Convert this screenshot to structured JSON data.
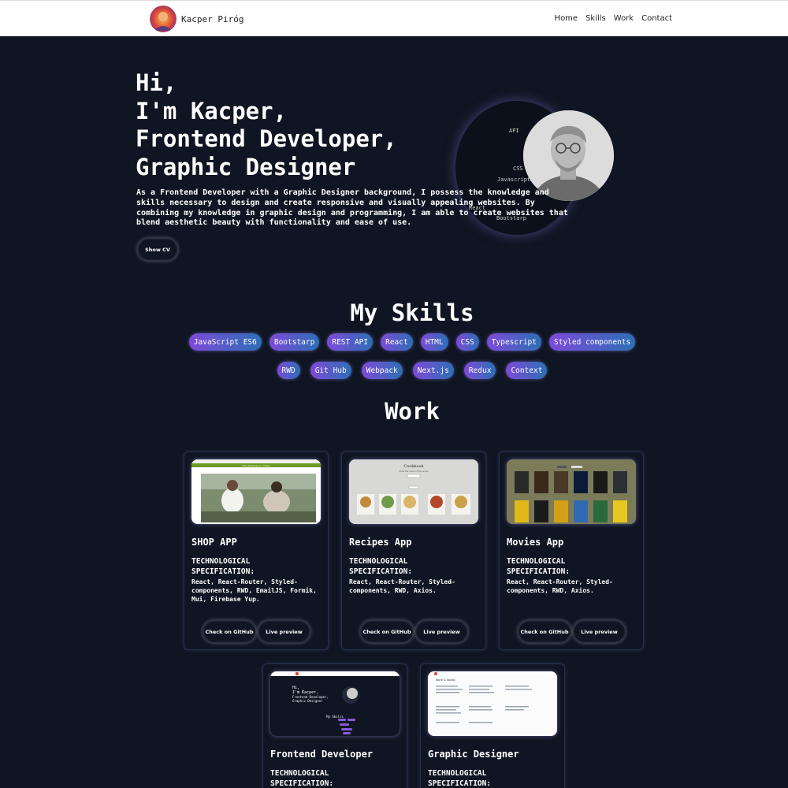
{
  "nav": {
    "brand": "Kacper Piróg",
    "links": [
      "Home",
      "Skills",
      "Work",
      "Contact"
    ]
  },
  "hero": {
    "lines": [
      "Hi,",
      "I'm Kacper,",
      "Frontend Developer,",
      "Graphic Designer"
    ],
    "text": "As a Frontend Developer with a Graphic Designer background, I possess the knowledge and skills necessary to design and create responsive and visually appealing websites. By combining my knowledge in graphic design and programming, I am able to create websites that blend aesthetic beauty with functionality and ease of use.",
    "button": "Show CV",
    "orbit_labels": [
      "API",
      "CSS",
      "Javascript",
      "React",
      "Bootstarp"
    ]
  },
  "skills": {
    "title": "My Skills",
    "row1": [
      "JavaScript ES6",
      "Bootstarp",
      "REST API",
      "React",
      "HTML",
      "CSS",
      "Typescript",
      "Styled components"
    ],
    "row2": [
      "RWD",
      "Git Hub",
      "Webpack",
      "Next.js",
      "Redux",
      "Context"
    ]
  },
  "work": {
    "title": "Work",
    "spec_label": "TECHNOLOGICAL SPECIFICATION:",
    "github_label": "Check on GitHub",
    "preview_label": "Live preview",
    "projects": [
      {
        "title": "SHOP APP",
        "stack": "React, React-Router, Styled-components, RWD, EmailJS, Formik, Mui, Firebase Yup."
      },
      {
        "title": "Recipes App",
        "stack": "React, React-Router, Styled-components, RWD, Axios."
      },
      {
        "title": "Movies App",
        "stack": "React, React-Router, Styled-components, RWD, Axios."
      },
      {
        "title": "Frontend Developer",
        "stack": ""
      },
      {
        "title": "Graphic Designer",
        "stack": ""
      }
    ],
    "thumbs": {
      "shop_banner": "Free shipping on orders",
      "recipes_title": "Cookbook",
      "recipes_tagline": "Write the name of the recipe",
      "fe_hi": "Hi,",
      "fe_name": "I'm Kacper,",
      "fe_role1": "Frontend Developer,",
      "fe_role2": "Graphic Designer",
      "fe_skills": "My Skills",
      "gd_title": "Work & studio"
    }
  },
  "colors": {
    "background": "#0f1522",
    "chip_start": "#7d4ad9",
    "chip_end": "#2c6fb6",
    "nav_bg": "#ffffff"
  }
}
